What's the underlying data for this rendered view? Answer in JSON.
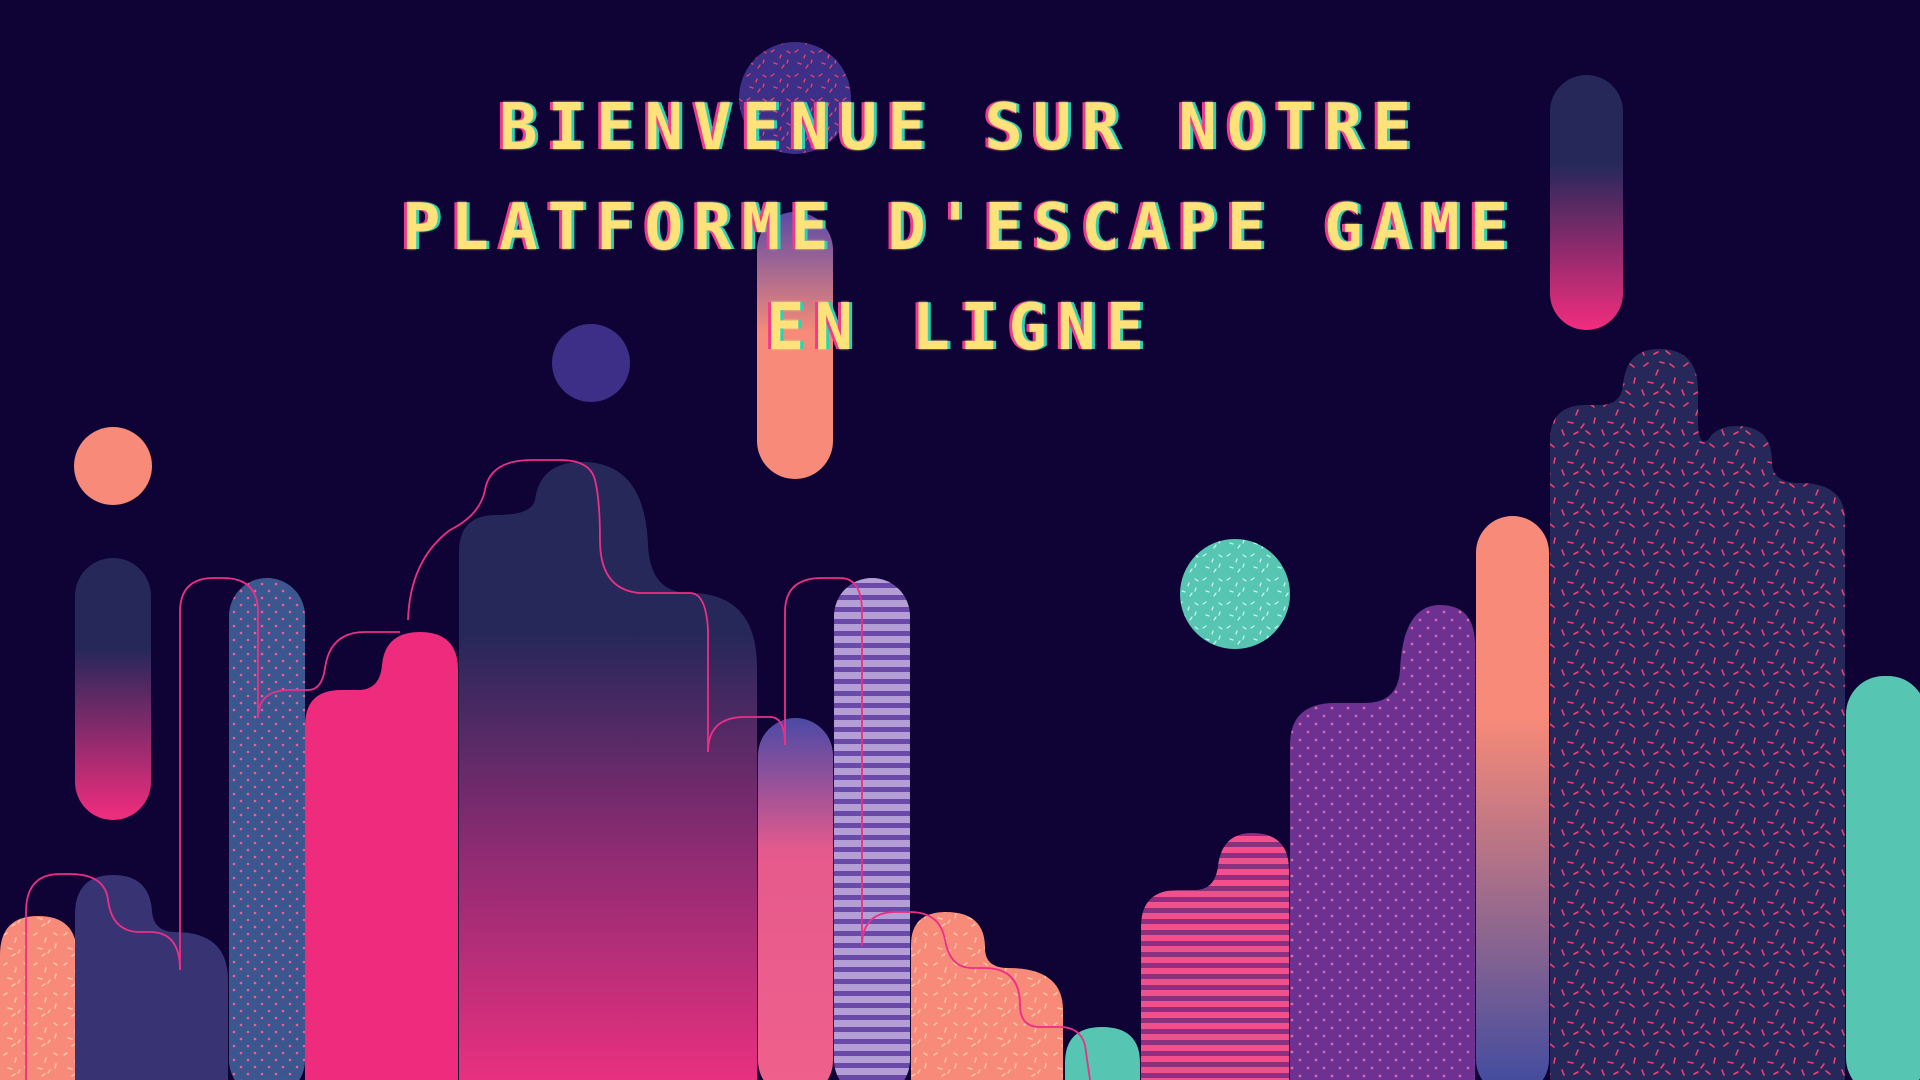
{
  "colors": {
    "background": "#0f0336",
    "title": "#ffe27a",
    "navy": "#26285a",
    "pink": "#f22d7e",
    "salmon": "#f78a78",
    "teal": "#56c6b2",
    "purple": "#6c3191",
    "indigo": "#3d2f87",
    "blue": "#3c5790",
    "lavender": "#b49ed6"
  },
  "title": {
    "line1": "Bienvenue sur notre",
    "line2": "platforme d'escape game",
    "line3": "en ligne"
  }
}
